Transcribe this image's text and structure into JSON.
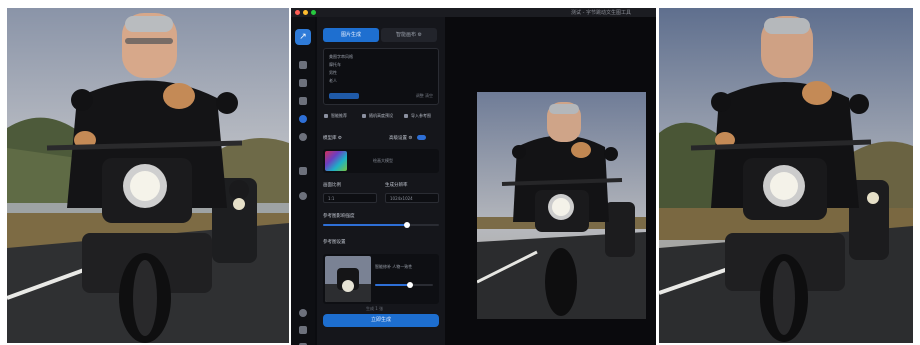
{
  "layout_description": "",
  "app": {
    "window_title": "测试 - 字节跳动文生图工具",
    "logo_glyph": "↗",
    "tabs": [
      {
        "label": "图片生成"
      },
      {
        "label": "智能画布 ⚙"
      }
    ],
    "prompt": {
      "lines": [
        "美图字串风格",
        "摩托车",
        "男性",
        "老人"
      ],
      "meta": "调整  清空"
    },
    "quick_actions": [
      "智能推荐",
      "随机高度预设",
      "导入参考图"
    ],
    "model_section_label": "模型库 ⚙",
    "advanced_label": "高级设置 ⚙",
    "model_name": "绘画大模型",
    "ratio_label": "画面比例",
    "resolution_label": "生成分辨率",
    "ratio_value": "1:1",
    "resolution_value": "1024x1024",
    "strength_label": "参考图影响强度",
    "reference_label": "参考图设置",
    "reference_text": "智能修补  人物一致性",
    "count_label": "生成 1 张",
    "generate_label": "立即生成"
  },
  "sliders": {
    "strength_fraction": 0.72,
    "reference_fraction": 0.6
  }
}
